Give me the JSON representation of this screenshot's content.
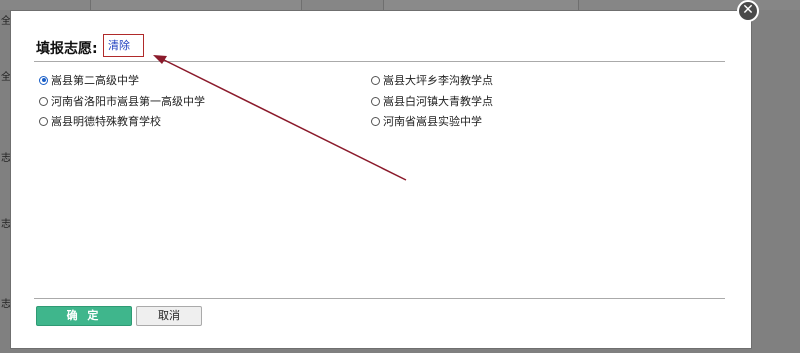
{
  "dialog": {
    "title": "填报志愿:",
    "clear_label": "清除",
    "close_glyph": "✕",
    "ok_label": "确 定",
    "cancel_label": "取消"
  },
  "options_left": [
    {
      "label": "嵩县第二高级中学",
      "checked": true
    },
    {
      "label": "河南省洛阳市嵩县第一高级中学",
      "checked": false
    },
    {
      "label": "嵩县明德特殊教育学校",
      "checked": false
    }
  ],
  "options_right": [
    {
      "label": "嵩县大坪乡李沟教学点",
      "checked": false
    },
    {
      "label": "嵩县白河镇大青教学点",
      "checked": false
    },
    {
      "label": "河南省嵩县实验中学",
      "checked": false
    }
  ],
  "background_labels": [
    "全",
    "全",
    "志",
    "志",
    "志",
    "志"
  ],
  "colors": {
    "ok_button": "#3fb68c",
    "annotation_arrow": "#8b1a2b",
    "link": "#1f3fbf",
    "radio_checked": "#1a5fc8"
  },
  "icons": {
    "close": "close-icon",
    "arrow": "annotation-arrow"
  }
}
